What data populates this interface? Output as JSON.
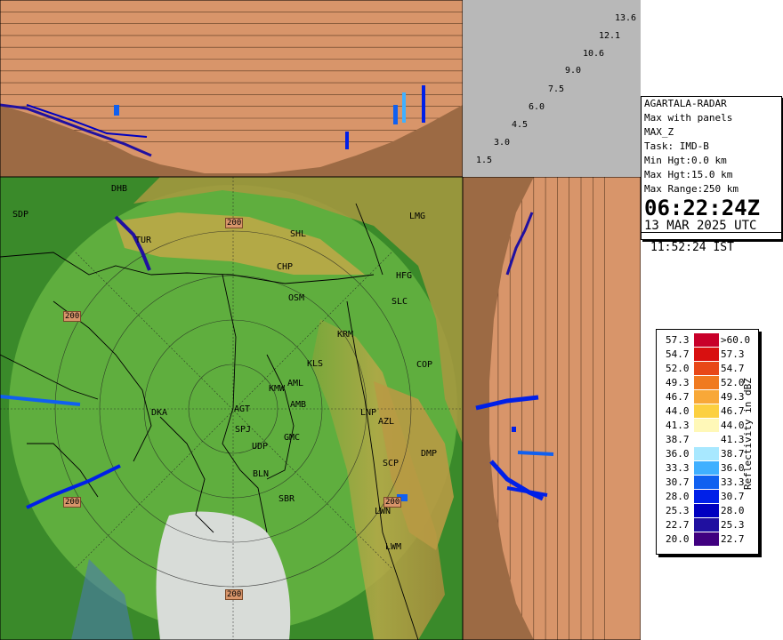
{
  "height_scale": {
    "labels": [
      "13.6",
      "12.1",
      "10.6",
      "9.0",
      "7.5",
      "6.0",
      "4.5",
      "3.0",
      "1.5"
    ]
  },
  "info": {
    "radar": "AGARTALA-RADAR",
    "product": "Max with panels",
    "product_code": "MAX_Z",
    "task": "Task: IMD-B",
    "min_hgt": "Min Hgt:0.0 km",
    "max_hgt": "Max Hgt:15.0 km",
    "max_range": "Max Range:250 km",
    "time_z": "06:22:24Z",
    "date_utc": "13 MAR 2025 UTC",
    "time_ist": "11:52:24 IST"
  },
  "legend": {
    "title": "Reflectivity in dBZ",
    "rows": [
      {
        "left": "57.3",
        "right": ">60.0",
        "color": "#c8002a"
      },
      {
        "left": "54.7",
        "right": "57.3",
        "color": "#d81010"
      },
      {
        "left": "52.0",
        "right": "54.7",
        "color": "#e84818"
      },
      {
        "left": "49.3",
        "right": "52.0",
        "color": "#f07a20"
      },
      {
        "left": "46.7",
        "right": "49.3",
        "color": "#f8a838"
      },
      {
        "left": "44.0",
        "right": "46.7",
        "color": "#fcd040"
      },
      {
        "left": "41.3",
        "right": "44.0",
        "color": "#fff8b8"
      },
      {
        "left": "38.7",
        "right": "41.3",
        "color": "#ffffff"
      },
      {
        "left": "36.0",
        "right": "38.7",
        "color": "#a8e8ff"
      },
      {
        "left": "33.3",
        "right": "36.0",
        "color": "#40b0ff"
      },
      {
        "left": "30.7",
        "right": "33.3",
        "color": "#1060f0"
      },
      {
        "left": "28.0",
        "right": "30.7",
        "color": "#0020e8"
      },
      {
        "left": "25.3",
        "right": "28.0",
        "color": "#0000c0"
      },
      {
        "left": "22.7",
        "right": "25.3",
        "color": "#2010a0"
      },
      {
        "left": "20.0",
        "right": "22.7",
        "color": "#400080"
      }
    ]
  },
  "range_ring_label": "200",
  "cities": [
    {
      "name": "DHB"
    },
    {
      "name": "SDP"
    },
    {
      "name": "TUR"
    },
    {
      "name": "SHL"
    },
    {
      "name": "LMG"
    },
    {
      "name": "CHP"
    },
    {
      "name": "HFG"
    },
    {
      "name": "OSM"
    },
    {
      "name": "SLC"
    },
    {
      "name": "KRM"
    },
    {
      "name": "KLS"
    },
    {
      "name": "COP"
    },
    {
      "name": "KMW"
    },
    {
      "name": "AML"
    },
    {
      "name": "AGT"
    },
    {
      "name": "DKA"
    },
    {
      "name": "AMB"
    },
    {
      "name": "LNP"
    },
    {
      "name": "AZL"
    },
    {
      "name": "SPJ"
    },
    {
      "name": "GMC"
    },
    {
      "name": "UDP"
    },
    {
      "name": "DMP"
    },
    {
      "name": "SCP"
    },
    {
      "name": "BLN"
    },
    {
      "name": "SBR"
    },
    {
      "name": "LWN"
    },
    {
      "name": "LWM"
    }
  ]
}
